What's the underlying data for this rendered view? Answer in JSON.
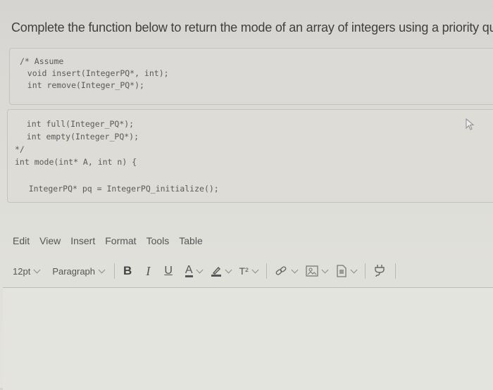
{
  "question": {
    "text": "Complete the function below to return the mode of an array of integers using a priority queue"
  },
  "code_block_1": {
    "lines": [
      "/* Assume",
      "   void insert(IntegerPQ*, int);",
      "   int remove(Integer_PQ*);"
    ]
  },
  "code_block_2": {
    "lines": [
      "   int full(Integer_PQ*);",
      "   int empty(Integer_PQ*);",
      "*/",
      "int mode(int* A, int n) {",
      "",
      "    IntegerPQ* pq = IntegerPQ_initialize();"
    ]
  },
  "editor": {
    "menu": [
      "Edit",
      "View",
      "Insert",
      "Format",
      "Tools",
      "Table"
    ],
    "font_size": "12pt",
    "block_format": "Paragraph",
    "toolbar": {
      "bold": "B",
      "italic": "I",
      "underline": "U",
      "text_color": "A",
      "highlight_icon": "pencil-highlight-icon",
      "superscript": "T²",
      "link_icon": "link-icon",
      "image_icon": "image-icon",
      "document_icon": "document-icon",
      "plugin_icon": "plug-icon"
    },
    "content": ""
  },
  "colors": {
    "background": "#dcdbd6",
    "code_background": "#dcdad6",
    "text": "#3f3f3f"
  }
}
